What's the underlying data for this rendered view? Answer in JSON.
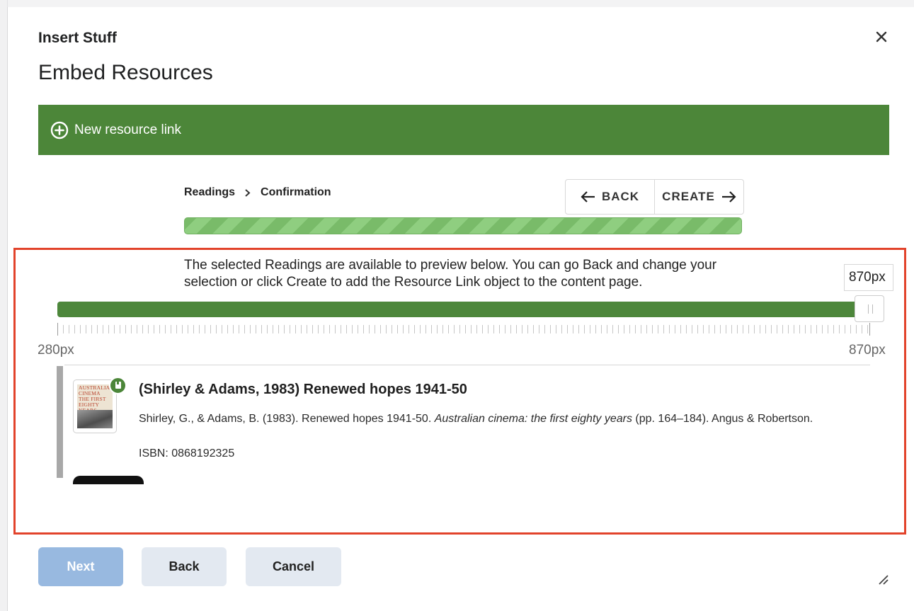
{
  "dialog": {
    "title": "Insert Stuff",
    "subtitle": "Embed Resources",
    "close_icon": "close-icon"
  },
  "header_bar": {
    "new_link_label": "New resource link",
    "icon": "plus-circle-icon",
    "color": "#4c8639"
  },
  "wizard": {
    "breadcrumb": [
      "Readings",
      "Confirmation"
    ],
    "back_label": "BACK",
    "create_label": "CREATE",
    "progress": 1.0,
    "message": "The selected Readings are available to preview below. You can go Back and change your selection or click Create to add the Resource Link object to the content page."
  },
  "width_slider": {
    "value": "870px",
    "min_label": "280px",
    "max_label": "870px",
    "level": 1.0
  },
  "preview": {
    "item_title": "(Shirley & Adams, 1983) Renewed hopes 1941-50",
    "citation_pre": "Shirley, G., & Adams, B. (1983). Renewed hopes 1941-50. ",
    "citation_italic": "Australian cinema: the first eighty years",
    "citation_post": " (pp. 164–184). Angus & Robertson.",
    "isbn": "ISBN: 0868192325",
    "cover_text": "AUSTRALIAN CINEMA THE FIRST EIGHTY YEARS",
    "badge_icon": "bookmark-icon"
  },
  "footer": {
    "next_label": "Next",
    "back_label": "Back",
    "cancel_label": "Cancel"
  },
  "colors": {
    "accent_green": "#4c8639",
    "highlight_border": "#e2432b",
    "next_disabled": "#98b9e0"
  }
}
